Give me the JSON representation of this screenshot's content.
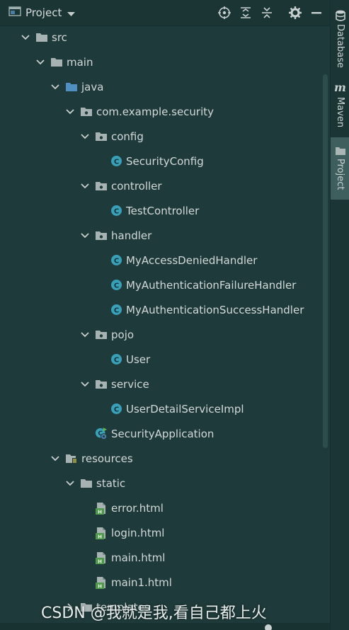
{
  "panel": {
    "title": "Project"
  },
  "right_tabs": [
    {
      "label": "Database"
    },
    {
      "label": "Maven"
    },
    {
      "label": "Project"
    }
  ],
  "tree": [
    {
      "label": "src",
      "depth": 0,
      "expanded": true,
      "icon": "folder-icon"
    },
    {
      "label": "main",
      "depth": 1,
      "expanded": true,
      "icon": "folder-icon"
    },
    {
      "label": "java",
      "depth": 2,
      "expanded": true,
      "icon": "source-folder-icon"
    },
    {
      "label": "com.example.security",
      "depth": 3,
      "expanded": true,
      "icon": "package-icon"
    },
    {
      "label": "config",
      "depth": 4,
      "expanded": true,
      "icon": "package-icon"
    },
    {
      "label": "SecurityConfig",
      "depth": 5,
      "icon": "class-icon"
    },
    {
      "label": "controller",
      "depth": 4,
      "expanded": true,
      "icon": "package-icon"
    },
    {
      "label": "TestController",
      "depth": 5,
      "icon": "class-icon"
    },
    {
      "label": "handler",
      "depth": 4,
      "expanded": true,
      "icon": "package-icon"
    },
    {
      "label": "MyAccessDeniedHandler",
      "depth": 5,
      "icon": "class-icon"
    },
    {
      "label": "MyAuthenticationFailureHandler",
      "depth": 5,
      "icon": "class-icon"
    },
    {
      "label": "MyAuthenticationSuccessHandler",
      "depth": 5,
      "icon": "class-icon"
    },
    {
      "label": "pojo",
      "depth": 4,
      "expanded": true,
      "icon": "package-icon"
    },
    {
      "label": "User",
      "depth": 5,
      "icon": "class-icon"
    },
    {
      "label": "service",
      "depth": 4,
      "expanded": true,
      "icon": "package-icon"
    },
    {
      "label": "UserDetailServiceImpl",
      "depth": 5,
      "icon": "class-icon"
    },
    {
      "label": "SecurityApplication",
      "depth": 4,
      "icon": "spring-boot-class-icon"
    },
    {
      "label": "resources",
      "depth": 2,
      "expanded": true,
      "icon": "resources-folder-icon"
    },
    {
      "label": "static",
      "depth": 3,
      "expanded": true,
      "icon": "folder-icon"
    },
    {
      "label": "error.html",
      "depth": 4,
      "icon": "html-file-icon"
    },
    {
      "label": "login.html",
      "depth": 4,
      "icon": "html-file-icon"
    },
    {
      "label": "main.html",
      "depth": 4,
      "icon": "html-file-icon"
    },
    {
      "label": "main1.html",
      "depth": 4,
      "icon": "html-file-icon"
    },
    {
      "label": "templates",
      "depth": 3,
      "expanded": false,
      "icon": "folder-icon"
    }
  ],
  "watermark": "CSDN @我就是我,看自己都上火"
}
